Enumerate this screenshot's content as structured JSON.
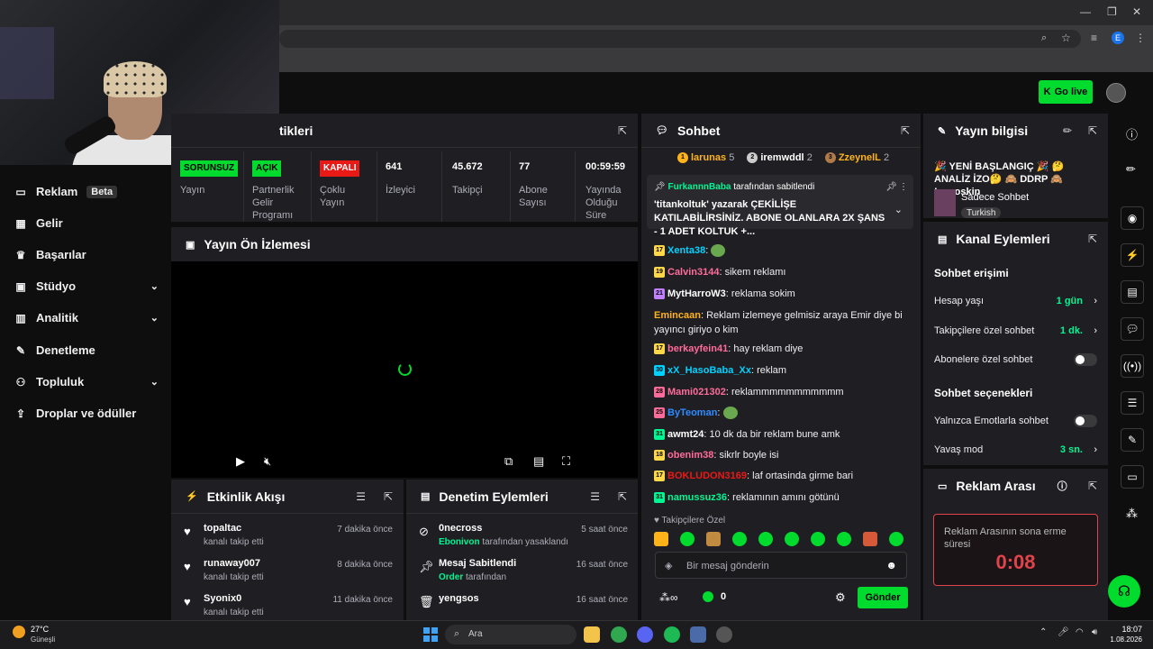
{
  "top_bar": {
    "go_live_label": "Go live"
  },
  "sidebar": {
    "items": [
      {
        "label": "Reklam",
        "badge": "Beta",
        "icon": "monitor-icon"
      },
      {
        "label": "Gelir",
        "icon": "chart-icon"
      },
      {
        "label": "Başarılar",
        "icon": "trophy-icon"
      },
      {
        "label": "Stüdyo",
        "icon": "film-icon"
      },
      {
        "label": "Analitik",
        "icon": "bar-chart-icon"
      },
      {
        "label": "Denetleme",
        "icon": "wrench-icon"
      },
      {
        "label": "Topluluk",
        "icon": "users-icon"
      },
      {
        "label": "Droplar ve ödüller",
        "icon": "upload-icon"
      }
    ]
  },
  "stats_panel": {
    "title_fragment": "tikleri",
    "cells": [
      {
        "tag": "SORUNSUZ",
        "label": "Yayın",
        "tag_color": "#00db2e"
      },
      {
        "tag": "AÇIK",
        "label": "Partnerlik Gelir Programı",
        "tag_color": "#00db2e"
      },
      {
        "tag": "KAPALI",
        "label": "Çoklu Yayın",
        "tag_color": "#e91916"
      },
      {
        "value": "641",
        "label": "İzleyici"
      },
      {
        "value": "45.672",
        "label": "Takipçi"
      },
      {
        "value": "77",
        "label": "Abone Sayısı"
      },
      {
        "value": "00:59:59",
        "label": "Yayında Olduğu Süre"
      }
    ]
  },
  "preview": {
    "title": "Yayın Ön İzlemesi"
  },
  "activity": {
    "title": "Etkinlik Akışı",
    "items": [
      {
        "name": "topaltac",
        "sub": "kanalı takip etti",
        "time": "7 dakika önce"
      },
      {
        "name": "runaway007",
        "sub": "kanalı takip etti",
        "time": "8 dakika önce"
      },
      {
        "name": "Syonix0",
        "sub": "kanalı takip etti",
        "time": "11 dakika önce"
      }
    ]
  },
  "moderation": {
    "title": "Denetim Eylemleri",
    "items": [
      {
        "name": "0necross",
        "actor": "Ebonivon",
        "sub": "tarafından yasaklandı",
        "time": "5 saat önce"
      },
      {
        "name": "Mesaj Sabitlendi",
        "actor": "Order",
        "sub": "tarafından",
        "time": "16 saat önce"
      },
      {
        "name": "yengsos",
        "actor": "",
        "sub": "",
        "time": "16 saat önce"
      }
    ]
  },
  "chat": {
    "title": "Sohbet",
    "leaders": [
      {
        "rank": "1",
        "name": "larunas",
        "count": "5"
      },
      {
        "rank": "2",
        "name": "iremwddl",
        "count": "2"
      },
      {
        "rank": "3",
        "name": "ZzeynelL",
        "count": "2"
      }
    ],
    "pinned": {
      "user": "FurkannnBaba",
      "by": "tarafından sabitlendi",
      "text": "'titankoltuk' yazarak ÇEKİLİŞE KATILABİLİRSİNİZ. ABONE OLANLARA 2X ŞANS - 1 ADET KOLTUK +..."
    },
    "messages": [
      {
        "badge": "17",
        "user": "Xenta38",
        "color": "#00d2ff",
        "text": ""
      },
      {
        "badge": "19",
        "user": "Calvin3144",
        "color": "#ff6b9a",
        "text": "sikem reklamı"
      },
      {
        "badge": "21",
        "user": "MytHarroW3",
        "color": "#ffffff",
        "text": "reklama sokim"
      },
      {
        "badge": "",
        "user": "Emincaan",
        "color": "#ffb31a",
        "text": "Reklam izlemeye gelmisiz araya Emir diye bi yayıncı giriyo o kim"
      },
      {
        "badge": "17",
        "user": "berkayfein41",
        "color": "#ff6b9a",
        "text": "hay reklam diye"
      },
      {
        "badge": "30",
        "user": "xX_HasoBaba_Xx",
        "color": "#00d2ff",
        "text": "reklam"
      },
      {
        "badge": "28",
        "user": "Mami021302",
        "color": "#ff6b9a",
        "text": "reklammmmmmmmmmm"
      },
      {
        "badge": "25",
        "user": "ByTeoman",
        "color": "#2e8bff",
        "text": ""
      },
      {
        "badge": "31",
        "user": "awmt24",
        "color": "#ffffff",
        "text": "10 dk da bir reklam bune amk"
      },
      {
        "badge": "18",
        "user": "obenim38",
        "color": "#ff6b9a",
        "text": "sikrlr boyle isi"
      },
      {
        "badge": "17",
        "user": "BOKLUDON3169",
        "color": "#e91916",
        "text": "laf ortasinda girme bari"
      },
      {
        "badge": "31",
        "user": "namussuz36",
        "color": "#00f593",
        "text": "reklamının amını götünü"
      }
    ],
    "followers_only_label": "Takipçilere Özel",
    "input_placeholder": "Bir mesaj gönderin",
    "points": "0",
    "send_label": "Gönder"
  },
  "stream_info": {
    "title": "Yayın bilgisi",
    "stream_title": "🎉 YENİ BAŞLANGIÇ 🎉 🤔 ANALİZ İZO🤔 🙈 DDRP 🙈 !csgoskin",
    "category": "Sadece Sohbet",
    "tag": "Turkish"
  },
  "channel_actions": {
    "title": "Kanal Eylemleri",
    "access_header": "Sohbet erişimi",
    "account_age_label": "Hesap yaşı",
    "account_age_value": "1 gün",
    "followers_label": "Takipçilere özel sohbet",
    "followers_value": "1 dk.",
    "subs_label": "Abonelere özel sohbet",
    "options_header": "Sohbet seçenekleri",
    "emotes_label": "Yalnızca Emotlarla sohbet",
    "slow_label": "Yavaş mod",
    "slow_value": "3 sn."
  },
  "ad_break": {
    "title": "Reklam Arası",
    "caption": "Reklam Arasının sona erme süresi",
    "timer": "0:08"
  },
  "taskbar": {
    "weather_temp": "27°C",
    "weather_label": "Güneşli",
    "search_placeholder": "Ara",
    "time": "18:07",
    "date": "1.08.2026"
  }
}
